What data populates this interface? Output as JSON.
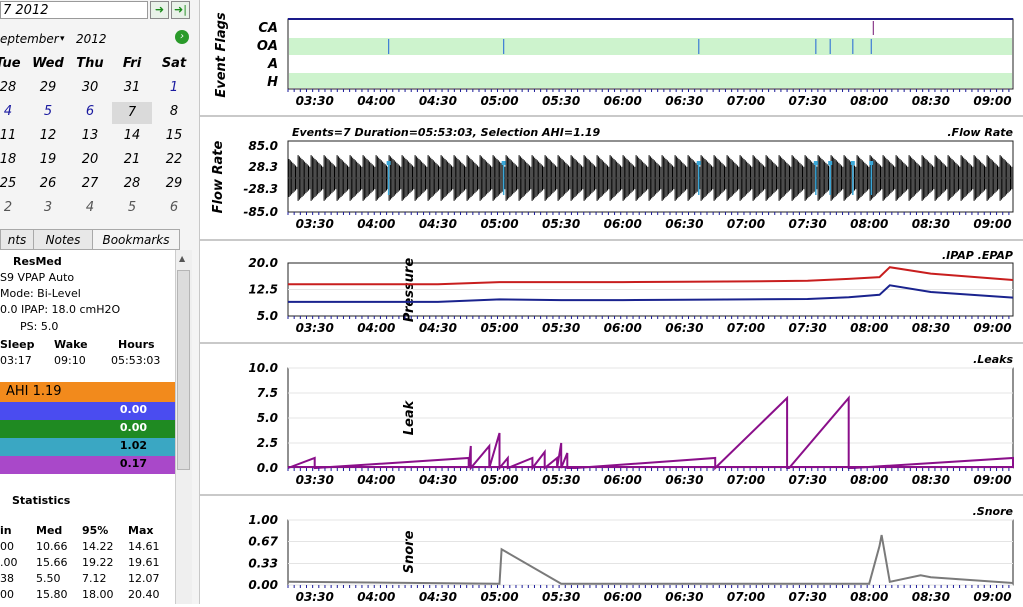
{
  "sidebar": {
    "date_field": "7 2012",
    "month_label": "eptember",
    "year_label": "2012",
    "weekday_headers": [
      "Tue",
      "Wed",
      "Thu",
      "Fri",
      "Sat"
    ],
    "calendar_rows": [
      [
        "28",
        "29",
        "30",
        "31",
        "1"
      ],
      [
        "4",
        "5",
        "6",
        "7",
        "8"
      ],
      [
        "11",
        "12",
        "13",
        "14",
        "15"
      ],
      [
        "18",
        "19",
        "20",
        "21",
        "22"
      ],
      [
        "25",
        "26",
        "27",
        "28",
        "29"
      ],
      [
        "2",
        "3",
        "4",
        "5",
        "6"
      ]
    ],
    "tabs": [
      "nts",
      "Notes",
      "Bookmarks"
    ],
    "device": {
      "brand": "ResMed",
      "model": "S9 VPAP Auto",
      "mode": "Mode: Bi-Level",
      "pressures": "0.0 IPAP: 18.0 cmH2O",
      "ps": "PS: 5.0",
      "sleep_header": "Sleep",
      "wake_header": "Wake",
      "hours_header": "Hours",
      "sleep_value": "03:17",
      "wake_value": "09:10",
      "hours_value": "05:53:03"
    },
    "ahi": {
      "label": "AHI 1.19",
      "rows": [
        "0.00",
        "0.00",
        "1.02",
        "0.17"
      ],
      "colors": [
        "#f28a1c",
        "#4a4cf0",
        "#1f8a22",
        "#3aa7c3",
        "#a948c9"
      ]
    },
    "statistics": {
      "title": "Statistics",
      "headers": [
        "in",
        "Med",
        "95%",
        "Max"
      ],
      "rows": [
        [
          "00",
          "10.66",
          "14.22",
          "14.61"
        ],
        [
          ".00",
          "15.66",
          "19.22",
          "19.61"
        ],
        [
          "38",
          "5.50",
          "7.12",
          "12.07"
        ],
        [
          "00",
          "15.80",
          "18.00",
          "20.40"
        ]
      ]
    }
  },
  "x_ticks": [
    "03:30",
    "04:00",
    "04:30",
    "05:00",
    "05:30",
    "06:00",
    "06:30",
    "07:00",
    "07:30",
    "08:00",
    "08:30",
    "09:00"
  ],
  "panels": {
    "event_flags": {
      "ylabel": "Event Flags",
      "rows": [
        "CA",
        "OA",
        "A",
        "H"
      ],
      "oa_event_times": [
        "04:06",
        "05:02",
        "06:37",
        "07:34",
        "07:41",
        "07:52",
        "08:01"
      ],
      "ca_event_times": [
        "08:02"
      ]
    },
    "flow_rate": {
      "ylabel": "Flow Rate",
      "title": "Events=7 Duration=05:53:03, Selection AHI=1.19",
      "legend": ".Flow Rate",
      "yticks": [
        "85.0",
        "28.3",
        "-28.3",
        "-85.0"
      ]
    },
    "pressure": {
      "ylabel": "Pressure",
      "legend": ".IPAP .EPAP",
      "yticks": [
        "20.0",
        "12.5",
        "5.0"
      ]
    },
    "leak": {
      "ylabel": "Leak",
      "legend": ".Leaks",
      "yticks": [
        "10.0",
        "7.5",
        "5.0",
        "2.5",
        "0.0"
      ]
    },
    "snore": {
      "ylabel": "Snore",
      "legend": ".Snore",
      "yticks": [
        "1.00",
        "0.67",
        "0.33",
        "0.00"
      ]
    }
  },
  "chart_data": [
    {
      "type": "line",
      "title": "",
      "ylabel": "Pressure",
      "ylim": [
        5.0,
        20.0
      ],
      "x": [
        "03:17",
        "04:30",
        "05:00",
        "05:30",
        "06:00",
        "06:30",
        "07:00",
        "07:30",
        "07:50",
        "08:05",
        "08:10",
        "08:30",
        "09:10"
      ],
      "series": [
        {
          "name": "IPAP",
          "color": "#c81e1e",
          "values": [
            14.0,
            14.0,
            14.6,
            14.6,
            14.6,
            14.7,
            14.8,
            15.0,
            15.5,
            16.0,
            18.8,
            17.0,
            15.2
          ]
        },
        {
          "name": "EPAP",
          "color": "#1a238e",
          "values": [
            9.0,
            9.0,
            9.7,
            9.5,
            9.5,
            9.6,
            9.7,
            9.8,
            10.3,
            11.0,
            13.7,
            11.8,
            10.2
          ]
        }
      ]
    },
    {
      "type": "line",
      "title": "",
      "ylabel": "Leak",
      "ylim": [
        0.0,
        10.0
      ],
      "x": [
        "03:17",
        "03:30",
        "04:45",
        "04:46",
        "04:55",
        "05:00",
        "05:04",
        "05:16",
        "05:22",
        "05:28",
        "05:30",
        "05:33",
        "05:37",
        "06:45",
        "07:20",
        "07:21",
        "07:50",
        "07:52",
        "09:10"
      ],
      "series": [
        {
          "name": "Leaks",
          "color": "#8a0f8a",
          "values": [
            0.0,
            1.0,
            1.0,
            2.2,
            2.2,
            3.5,
            1.0,
            1.0,
            1.6,
            1.0,
            2.5,
            1.5,
            0.0,
            1.0,
            7.0,
            0.0,
            7.0,
            0.0,
            1.0
          ]
        }
      ]
    },
    {
      "type": "line",
      "title": "",
      "ylabel": "Snore",
      "ylim": [
        0.0,
        1.0
      ],
      "x": [
        "03:17",
        "05:00",
        "05:01",
        "05:30",
        "07:00",
        "08:00",
        "08:05",
        "08:06",
        "08:10",
        "08:25",
        "08:30",
        "09:10"
      ],
      "series": [
        {
          "name": "Snore",
          "color": "#7a7a7a",
          "values": [
            0.05,
            0.02,
            0.55,
            0.02,
            0.02,
            0.02,
            0.6,
            0.77,
            0.05,
            0.15,
            0.12,
            0.03
          ]
        }
      ]
    }
  ]
}
